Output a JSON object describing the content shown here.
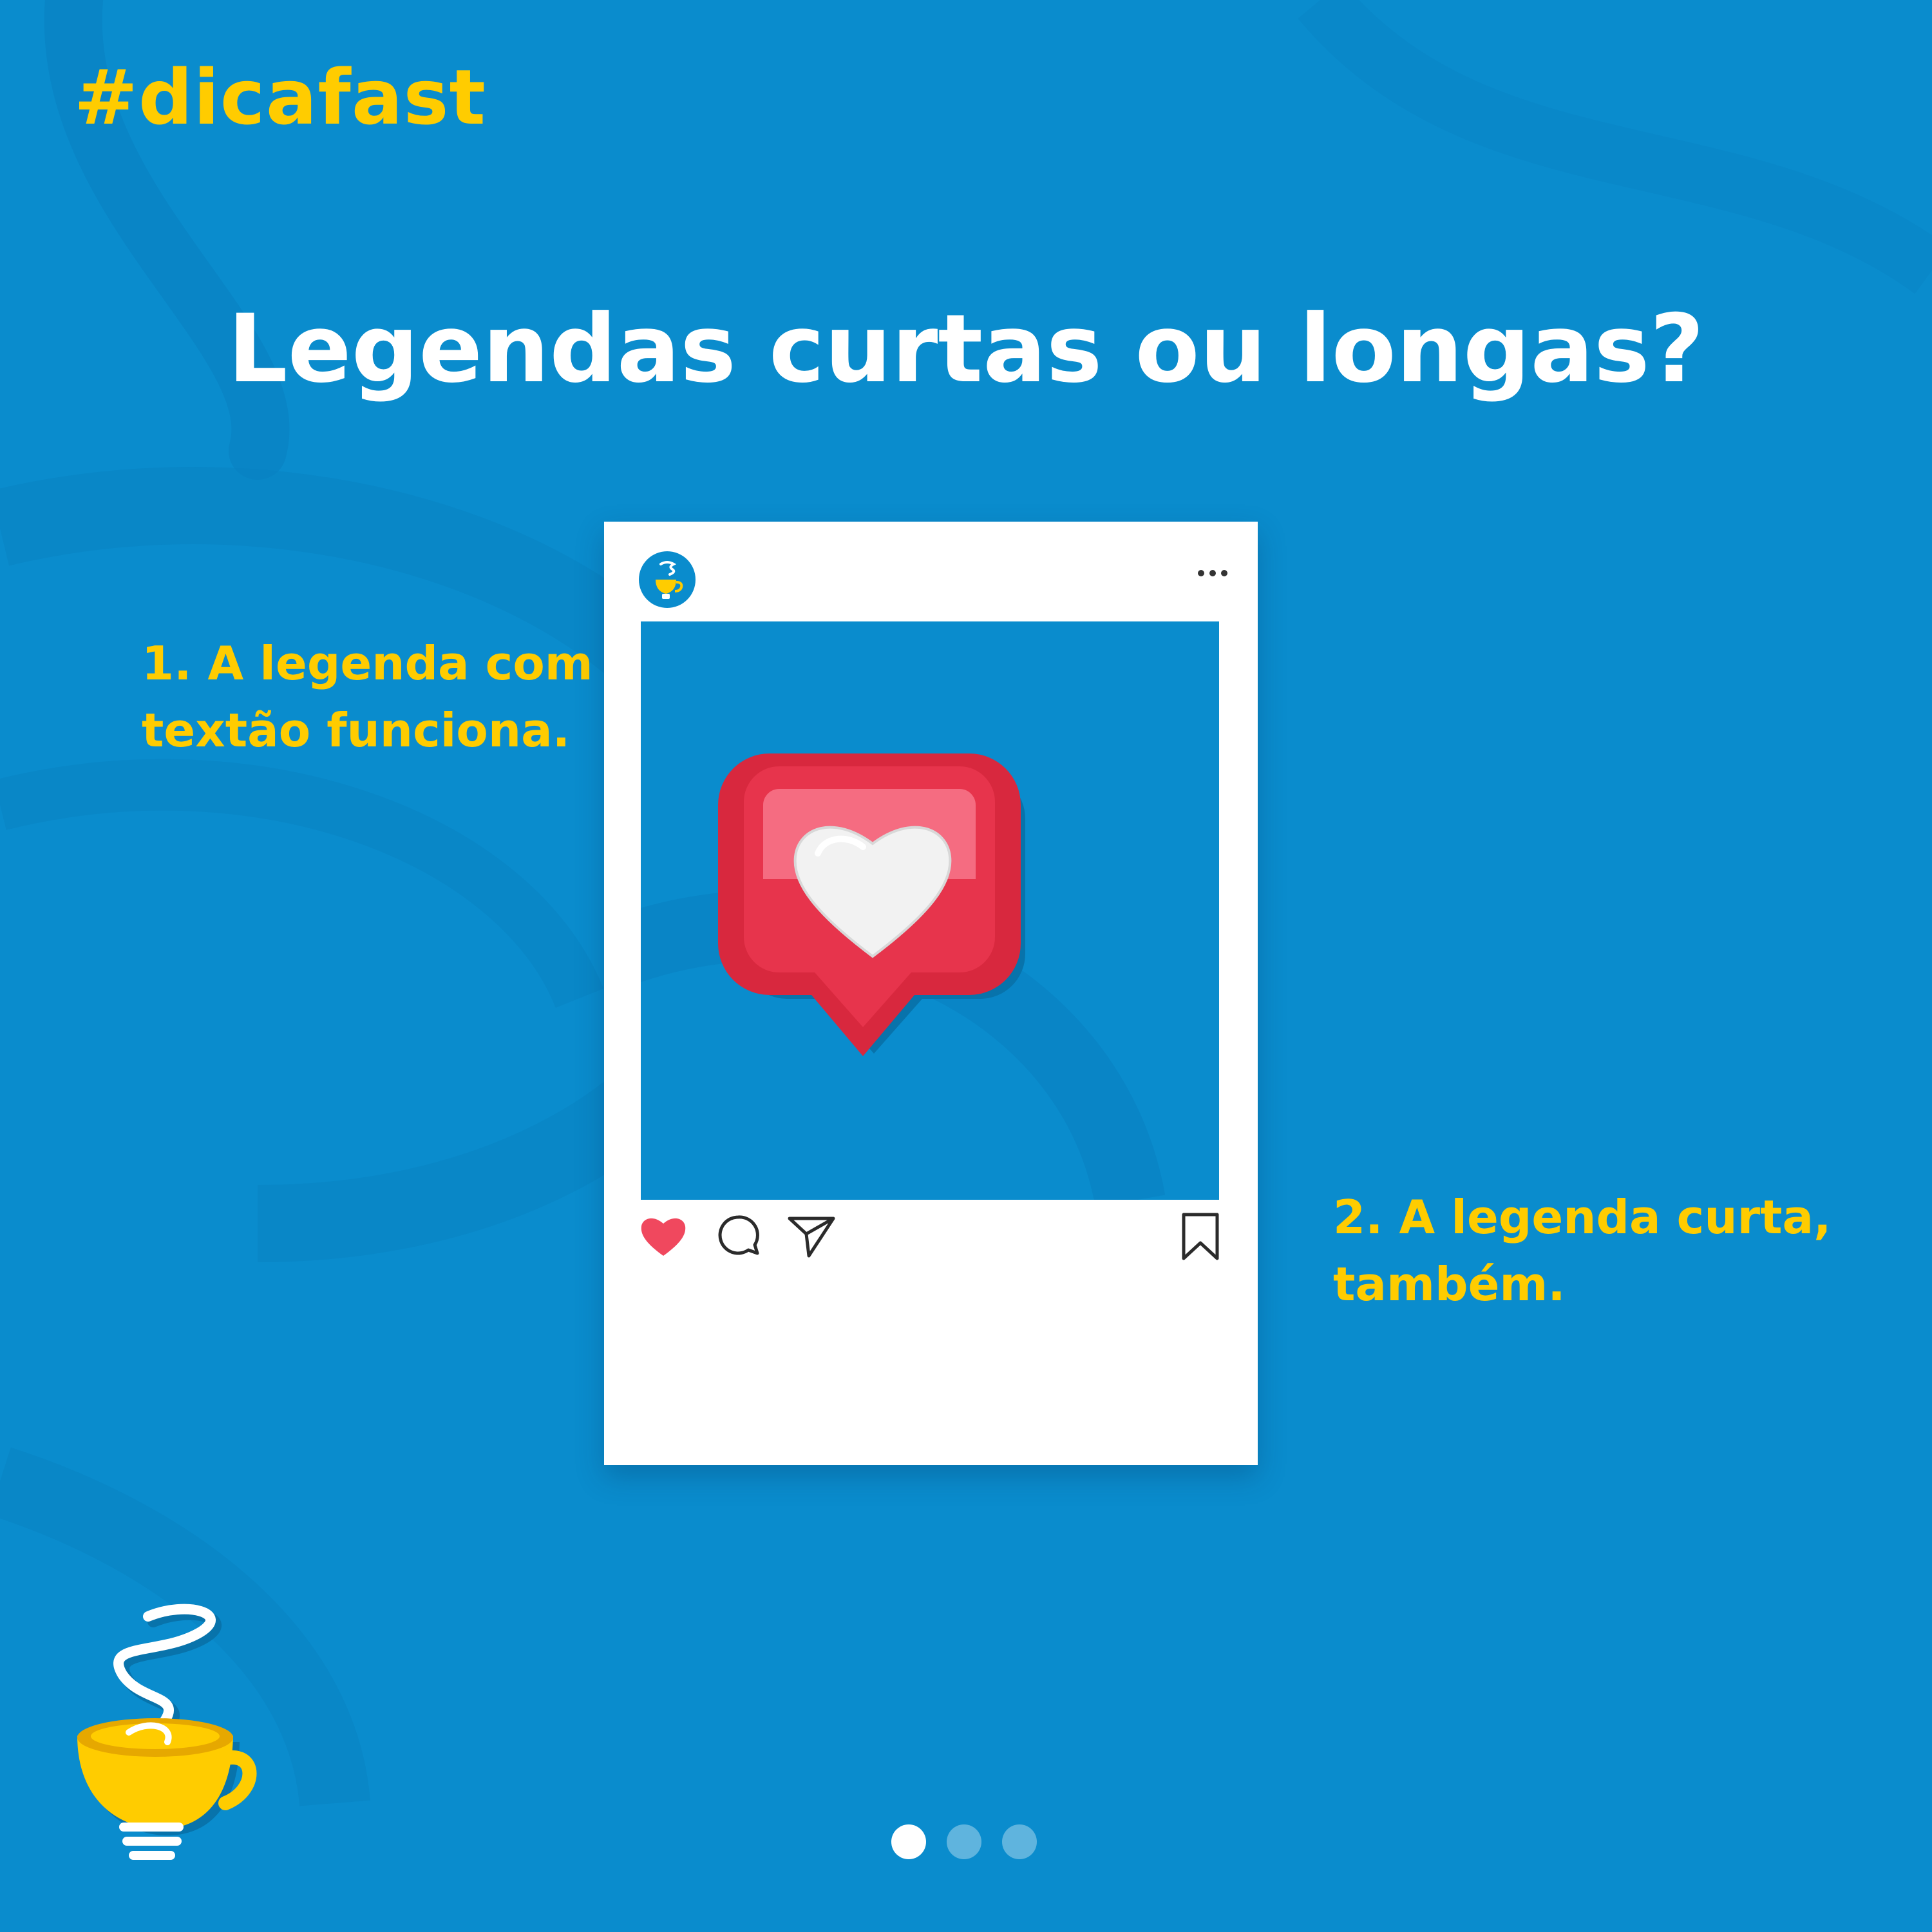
{
  "brand": {
    "hashtag": "#dicafast",
    "accent_color": "#ffcc00",
    "background_color": "#0a8ccd",
    "logo_icon": "coffee-cup-lightbulb-icon"
  },
  "headline": "Legendas curtas ou longas?",
  "tips": [
    {
      "line1": "1. A legenda com",
      "line2": "textão funciona."
    },
    {
      "line1": "2. A legenda curta,",
      "line2": "também."
    }
  ],
  "post_mockup": {
    "avatar_icon": "coffee-cup-avatar-icon",
    "menu_icon": "more-dots-icon",
    "image_icon": "like-notification-heart-icon",
    "actions": [
      "heart-icon",
      "comment-icon",
      "send-icon",
      "bookmark-icon"
    ],
    "like_color": "#f0485e"
  },
  "pager": {
    "pages": 3,
    "current": 1
  }
}
